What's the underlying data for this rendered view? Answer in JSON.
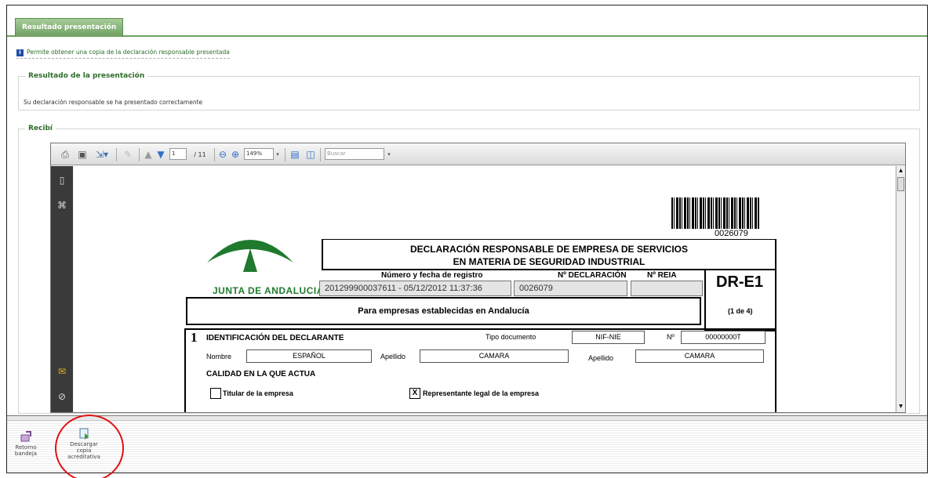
{
  "tab": {
    "label": "Resultado presentación"
  },
  "info": {
    "text": "Permite obtener una copia de la declaración responsable presentada"
  },
  "resultado": {
    "legend": "Resultado de la presentación",
    "message": "Su declaración responsable se ha presentado correctamente"
  },
  "recibi": {
    "legend": "Recibí"
  },
  "pdf_toolbar": {
    "page_current": "1",
    "page_total": "/ 11",
    "zoom": "149%",
    "search_placeholder": "Buscar"
  },
  "document": {
    "barcode_number": "0026079",
    "logo_text": "JUNTA DE ANDALUCIA",
    "title_line1": "DECLARACIÓN RESPONSABLE DE EMPRESA DE SERVICIOS",
    "title_line2": "EN MATERIA DE SEGURIDAD INDUSTRIAL",
    "registro_label": "Número y fecha de registro",
    "registro_value": "201299900037611 - 05/12/2012 11:37:36",
    "declaracion_label": "Nº DECLARACIÓN",
    "declaracion_value": "0026079",
    "reia_label": "Nº REIA",
    "reia_value": "",
    "form_code": "DR-E1",
    "form_pages": "(1 de 4)",
    "establecidas": "Para empresas establecidas en Andalucía",
    "section_number": "1",
    "section_title": "IDENTIFICACIÓN DEL DECLARANTE",
    "tipo_doc_label": "Tipo documento",
    "tipo_doc_value": "NIF-NIE",
    "num_label": "Nº",
    "num_value": "00000000T",
    "nombre_label": "Nombre",
    "nombre_value": "ESPAÑOL",
    "apellido1_label": "Apellido",
    "apellido1_value": "CAMARA",
    "apellido2_label": "Apellido",
    "apellido2_value": "CAMARA",
    "calidad_title": "CALIDAD EN LA QUE ACTUA",
    "titular_label": "Titular de la empresa",
    "titular_checked": "",
    "representante_label": "Representante legal de la empresa",
    "representante_checked": "X"
  },
  "bottom_buttons": {
    "retorno": "Retorno bandeja",
    "descargar": "Descargar copia acreditativa"
  },
  "colors": {
    "accent_green": "#2d6c2b",
    "tab_green": "#6f9f61",
    "highlight_red": "#e01010"
  }
}
